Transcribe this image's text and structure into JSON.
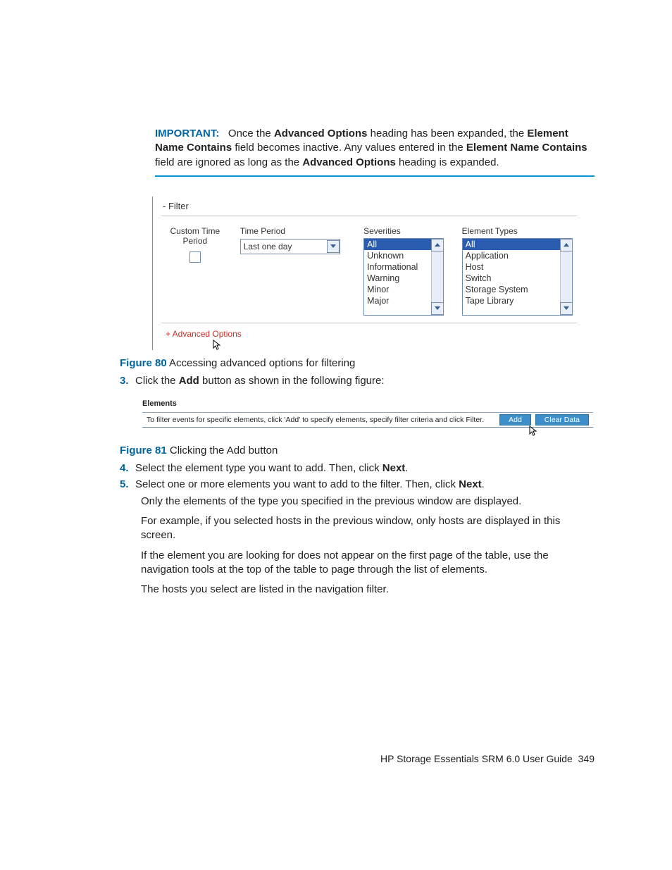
{
  "important": {
    "label": "IMPORTANT:",
    "t1a": "Once the ",
    "b1": "Advanced Options",
    "t1b": " heading has been expanded, the ",
    "b2": "Element Name Contains",
    "t1c": " field becomes inactive. Any values entered in the ",
    "b3": "Element Name Contains",
    "t1d": " field are ignored as long as the ",
    "b4": "Advanced Options",
    "t1e": " heading is expanded."
  },
  "fig80": {
    "panel_title": "- Filter",
    "custom_time_label_a": "Custom Time",
    "custom_time_label_b": "Period",
    "time_period_label": "Time Period",
    "time_period_value": "Last one day",
    "severities_label": "Severities",
    "severities": [
      "All",
      "Unknown",
      "Informational",
      "Warning",
      "Minor",
      "Major"
    ],
    "element_types_label": "Element Types",
    "element_types": [
      "All",
      "Application",
      "Host",
      "Switch",
      "Storage System",
      "Tape Library"
    ],
    "advanced_options": "+ Advanced Options",
    "caption_num": "Figure 80",
    "caption_text": " Accessing advanced options for filtering"
  },
  "step3": {
    "num": "3.",
    "pre": "Click the ",
    "bold": "Add",
    "post": " button as shown in the following figure:"
  },
  "fig81": {
    "hdr": "Elements",
    "txt": "To filter events for specific elements, click 'Add' to specify elements, specify filter criteria and click Filter.",
    "add_btn": "Add",
    "clear_btn": "Clear Data",
    "caption_num": "Figure 81",
    "caption_text": " Clicking the Add button"
  },
  "step4": {
    "num": "4.",
    "pre": "Select the element type you want to add. Then, click ",
    "bold": "Next",
    "post": "."
  },
  "step5": {
    "num": "5.",
    "pre": "Select one or more elements you want to add to the filter. Then, click ",
    "bold": "Next",
    "post": ".",
    "p1": "Only the elements of the type you specified in the previous window are displayed.",
    "p2": "For example, if you selected hosts in the previous window, only hosts are displayed in this screen.",
    "p3": "If the element you are looking for does not appear on the first page of the table, use the navigation tools at the top of the table to page through the list of elements.",
    "p4": "The hosts you select are listed in the navigation filter."
  },
  "footer": {
    "title": "HP Storage Essentials SRM 6.0 User Guide",
    "page": "349"
  }
}
